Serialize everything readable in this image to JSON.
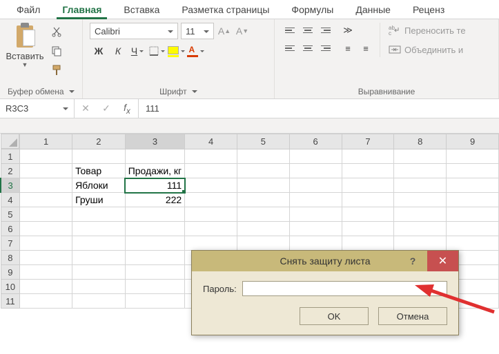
{
  "tabs": {
    "t0": "Файл",
    "t1": "Главная",
    "t2": "Вставка",
    "t3": "Разметка страницы",
    "t4": "Формулы",
    "t5": "Данные",
    "t6": "Реценз"
  },
  "ribbon": {
    "clipboard": {
      "paste": "Вставить",
      "label": "Буфер обмена"
    },
    "font": {
      "name": "Calibri",
      "size": "11",
      "bold": "Ж",
      "italic": "К",
      "underline": "Ч",
      "label": "Шрифт"
    },
    "align": {
      "wrap": "Переносить те",
      "merge": "Объединить и",
      "label": "Выравнивание"
    }
  },
  "fbar": {
    "ref": "R3C3",
    "value": "111"
  },
  "cols": {
    "c1": "1",
    "c2": "2",
    "c3": "3",
    "c4": "4",
    "c5": "5",
    "c6": "6",
    "c7": "7",
    "c8": "8",
    "c9": "9"
  },
  "rows": {
    "r1": "1",
    "r2": "2",
    "r3": "3",
    "r4": "4",
    "r5": "5",
    "r6": "6",
    "r7": "7",
    "r8": "8",
    "r9": "9",
    "r10": "10",
    "r11": "11"
  },
  "cells": {
    "b2": "Товар",
    "c2": "Продажи, кг",
    "b3": "Яблоки",
    "c3": "111",
    "b4": "Груши",
    "c4": "222"
  },
  "dialog": {
    "title": "Снять защиту листа",
    "label": "Пароль:",
    "ok": "OK",
    "cancel": "Отмена"
  }
}
